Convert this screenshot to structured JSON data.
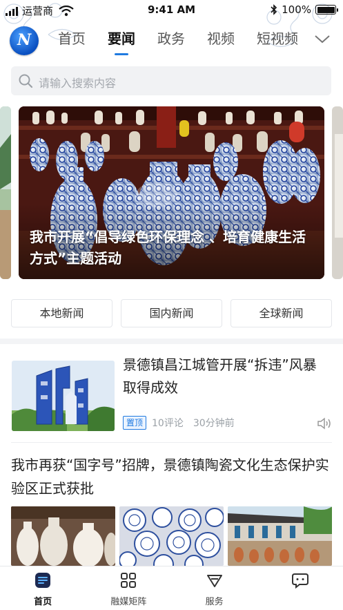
{
  "status_bar": {
    "carrier": "运营商",
    "time": "9:41 AM",
    "battery_text": "100%",
    "battery_level": 1.0
  },
  "nav": {
    "logo_letter": "N",
    "tabs": [
      "首页",
      "要闻",
      "政务",
      "视频",
      "短视频"
    ],
    "active_tab": "要闻",
    "more_icon": "chevron-down-icon"
  },
  "search": {
    "placeholder": "请输入搜索内容",
    "icon": "search-icon"
  },
  "banner": {
    "caption": "我市开展“倡导绿色环保理念 、培育健康生活方式”主题活动",
    "image": "blue-and-white-porcelain-vases"
  },
  "categories": [
    "本地新闻",
    "国内新闻",
    "全球新闻"
  ],
  "news": {
    "item1": {
      "title": "景德镇昌江城管开展“拆违”风暴取得成效",
      "pin_label": "置顶",
      "comments": "10评论",
      "time": "30分钟前",
      "speaker_icon": "speaker-icon"
    },
    "item2": {
      "title": "我市再获“国字号”招牌，景德镇陶瓷文化生态保护实验区正式获批"
    }
  },
  "bottom_nav": [
    {
      "label": "首页",
      "icon": "home-icon",
      "active": true
    },
    {
      "label": "融媒矩阵",
      "icon": "grid-icon",
      "active": false
    },
    {
      "label": "服务",
      "icon": "service-icon",
      "active": false
    },
    {
      "label": "",
      "icon": "chat-icon",
      "active": false
    }
  ],
  "colors": {
    "accent": "#1f7ae0",
    "text": "#222222",
    "muted": "#9aa0a6",
    "search_bg": "#f1f2f4"
  }
}
